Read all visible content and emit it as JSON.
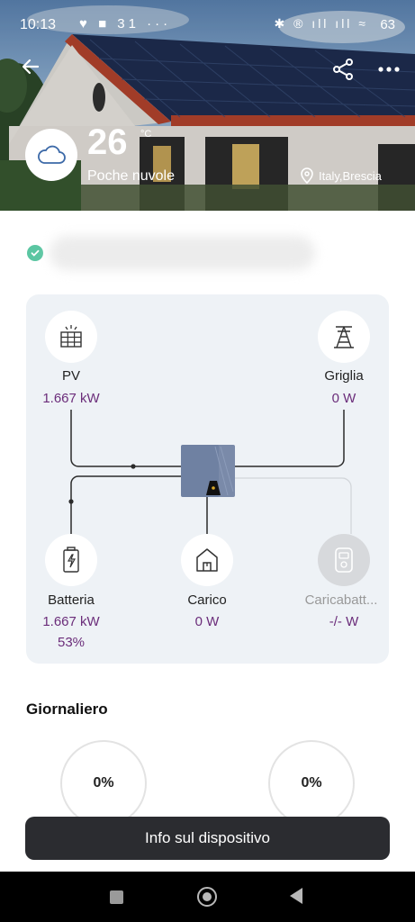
{
  "status_bar": {
    "time": "10:13",
    "left_icons": "♥ ■ 31 ···",
    "right_icons": "✱ ® ıll ıll ≈",
    "battery": "63"
  },
  "weather": {
    "temperature": "26",
    "unit": "°C",
    "condition": "Poche nuvole",
    "location": "Italy,Brescia",
    "icon": "cloud-icon"
  },
  "device": {
    "status": "online"
  },
  "flow": {
    "pv": {
      "label": "PV",
      "value": "1.667 kW",
      "icon": "solar-panel-icon"
    },
    "grid": {
      "label": "Griglia",
      "value": "0 W",
      "icon": "power-tower-icon"
    },
    "battery": {
      "label": "Batteria",
      "value": "1.667 kW",
      "percent": "53%",
      "icon": "battery-icon"
    },
    "load": {
      "label": "Carico",
      "value": "0 W",
      "icon": "house-icon"
    },
    "charger": {
      "label": "Caricabatt...",
      "value": "-/- W",
      "icon": "ev-charger-icon"
    }
  },
  "daily": {
    "title": "Giornaliero",
    "ring_left": "0%",
    "ring_right": "0%"
  },
  "actions": {
    "info_button": "Info sul dispositivo"
  },
  "colors": {
    "accent": "#6b2d7a",
    "card_bg": "#eef2f6",
    "button_bg": "#2b2c30",
    "check_green": "#5bc6a2"
  }
}
